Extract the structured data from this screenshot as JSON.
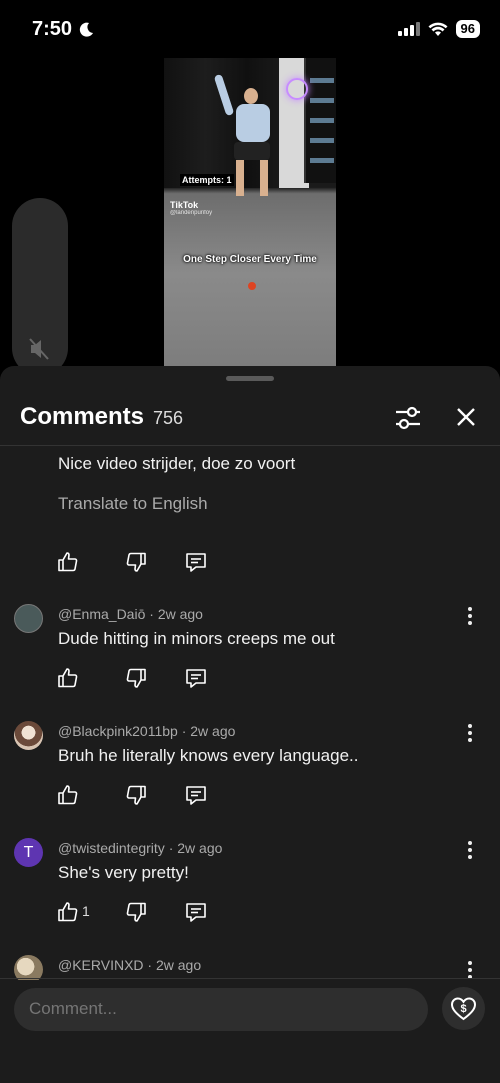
{
  "status_bar": {
    "time": "7:50",
    "battery": "96"
  },
  "video": {
    "overlay_attempts": "Attempts: 1",
    "overlay_brand": "TikTok",
    "overlay_handle": "@landenpurifoy",
    "overlay_caption": "One Step Closer Every Time"
  },
  "comments_sheet": {
    "title": "Comments",
    "count": "756",
    "comments": [
      {
        "author": "",
        "time": "",
        "text": "Nice video strijder, doe zo voort",
        "translate": "Translate to English",
        "likes": "",
        "avatar_color": "#2db84d"
      },
      {
        "author": "@Enma_Daiō",
        "time": "2w ago",
        "text": "Dude hitting in minors creeps me out",
        "likes": "",
        "avatar_color": "#4a5a5a"
      },
      {
        "author": "@Blackpink2011bp",
        "time": "2w ago",
        "text": "Bruh he literally knows every language..",
        "likes": "",
        "avatar_color": "#d8c4b2"
      },
      {
        "author": "@twistedintegrity",
        "time": "2w ago",
        "text": "She's very pretty!",
        "likes": "1",
        "avatar_letter": "T",
        "avatar_color": "#5e35b1"
      },
      {
        "author": "@KERVINXD",
        "time": "2w ago",
        "text": "",
        "likes": "",
        "avatar_color": "#b8a78a"
      }
    ]
  },
  "composer": {
    "placeholder": "Comment..."
  },
  "colors": {
    "sheet_bg": "#1c1c1c",
    "text": "#f1f1f1",
    "secondary": "#aaaaaa"
  }
}
